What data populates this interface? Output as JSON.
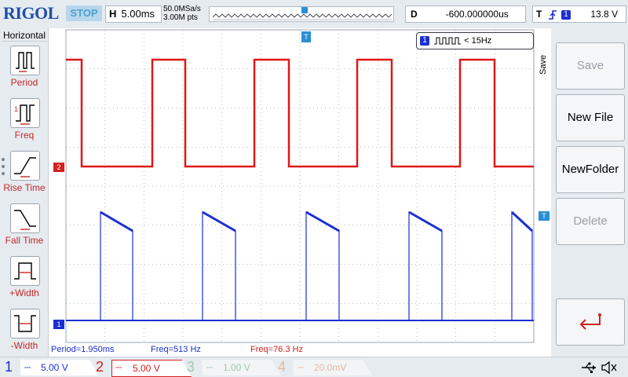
{
  "app": {
    "brand": "RIGOL",
    "run_state": "STOP"
  },
  "horizontal": {
    "label": "H",
    "timebase": "5.00ms",
    "sample_rate": "50.0MSa/s",
    "memory_depth": "3.00M pts"
  },
  "delay": {
    "label": "D",
    "value": "-600.000000us"
  },
  "trigger": {
    "label": "T",
    "source": "1",
    "level": "13.8 V"
  },
  "left_menu": {
    "title": "Horizontal",
    "items": [
      {
        "label": "Period",
        "icon": "period-icon"
      },
      {
        "label": "Freq",
        "icon": "freq-icon"
      },
      {
        "label": "Rise Time",
        "icon": "rise-time-icon"
      },
      {
        "label": "Fall Time",
        "icon": "fall-time-icon"
      },
      {
        "label": "+Width",
        "icon": "pos-width-icon"
      },
      {
        "label": "-Width",
        "icon": "neg-width-icon"
      }
    ]
  },
  "scope": {
    "marker_ch2": "2",
    "marker_ch1": "1",
    "marker_trigger": "T",
    "freq_counter": {
      "channel": "1",
      "text": "< 15Hz"
    }
  },
  "right_menu": {
    "tab_label": "Save",
    "buttons": [
      {
        "label": "Save",
        "enabled": false
      },
      {
        "label": "New File",
        "enabled": true
      },
      {
        "label": "NewFolder",
        "enabled": true
      },
      {
        "label": "Delete",
        "enabled": false
      }
    ]
  },
  "measurements": [
    {
      "text": "Period=1.950ms",
      "color": "#1a2fd1"
    },
    {
      "text": "Freq=513 Hz",
      "color": "#1a2fd1"
    },
    {
      "text": "Freq=76.3 Hz",
      "color": "#d32020"
    }
  ],
  "channels": [
    {
      "num": "1",
      "scale": "5.00 V",
      "color": "#1a2fd1",
      "active": true
    },
    {
      "num": "2",
      "scale": "5.00 V",
      "color": "#d32020",
      "active": true
    },
    {
      "num": "3",
      "scale": "1.00 V",
      "color": "#9ccaa8",
      "active": false
    },
    {
      "num": "4",
      "scale": "20.0mV",
      "color": "#e8b8a0",
      "active": false
    }
  ],
  "colors": {
    "ch1": "#1a2fd1",
    "ch2": "#e01818",
    "grid": "#9aa4b0",
    "panel": "#e6ebf0",
    "accent": "#1f4fa6"
  }
}
